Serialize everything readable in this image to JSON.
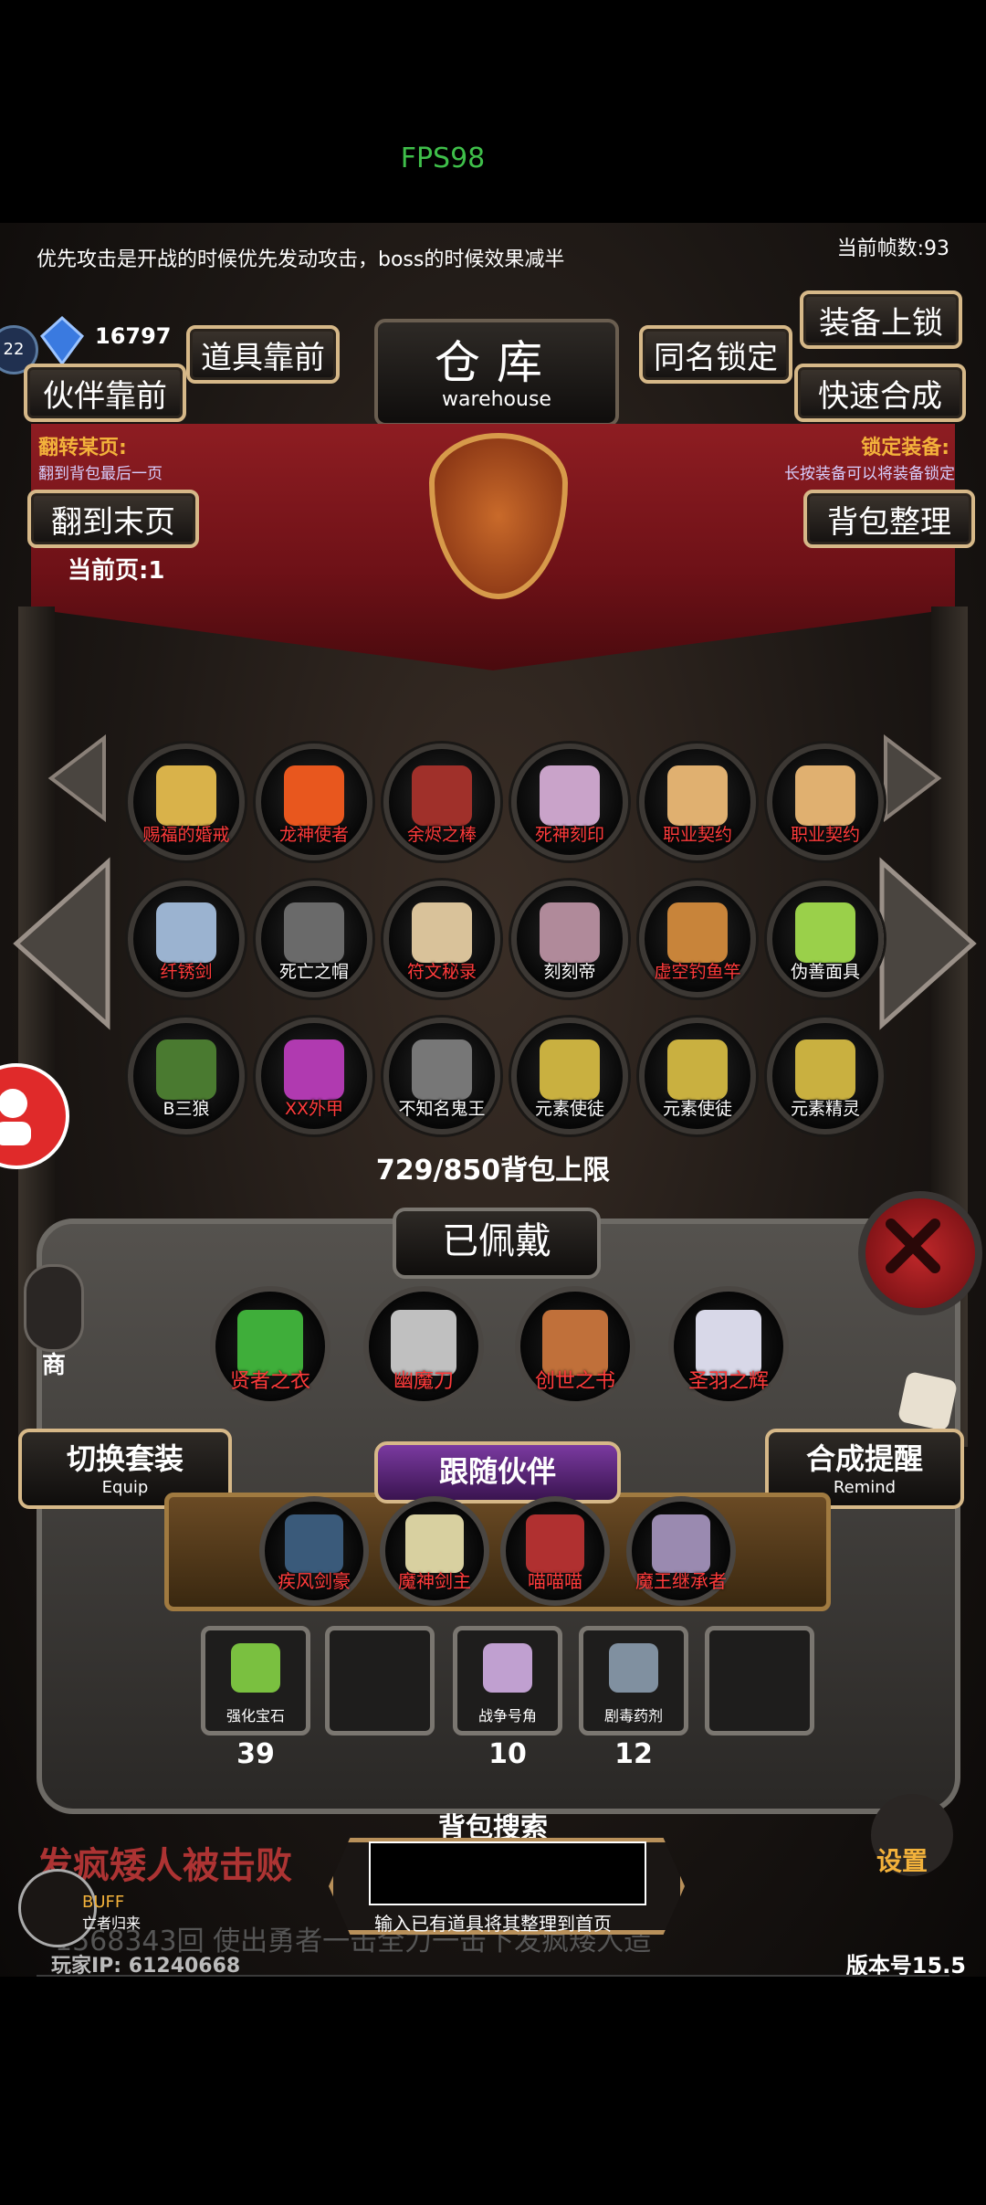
{
  "status": {
    "fps": "FPS98"
  },
  "header": {
    "tip": "优先攻击是开战的时候优先发动攻击，boss的时候效果减半",
    "frame_rate": "当前帧数:93",
    "gems": "16797",
    "level": "22"
  },
  "buttons": {
    "items_front": "道具靠前",
    "partner_front": "伙伴靠前",
    "same_name_lock": "同名锁定",
    "equip_lock": "装备上锁",
    "quick_merge": "快速合成",
    "to_last_page": "翻到末页",
    "bag_sort": "背包整理",
    "switch_set": "切换套装",
    "switch_set_sub": "Equip",
    "merge_remind": "合成提醒",
    "merge_remind_sub": "Remind",
    "settings": "设置"
  },
  "warehouse": {
    "title": "仓库",
    "subtitle": "warehouse"
  },
  "info": {
    "flip_title": "翻转某页:",
    "flip_desc": "翻到背包最后一页",
    "lock_title": "锁定装备:",
    "lock_desc": "长按装备可以将装备锁定",
    "current_page": "当前页:1"
  },
  "items": [
    {
      "name": "赐福的婚戒",
      "color": "#d9b24a",
      "label_color": "red"
    },
    {
      "name": "龙神使者",
      "color": "#e8571e",
      "label_color": "red"
    },
    {
      "name": "余烬之棒",
      "color": "#a0302a",
      "label_color": "red"
    },
    {
      "name": "死神刻印",
      "color": "#c9a3c9",
      "label_color": "red"
    },
    {
      "name": "职业契约",
      "color": "#e0b070",
      "label_color": "red"
    },
    {
      "name": "职业契约",
      "color": "#e0b070",
      "label_color": "red"
    },
    {
      "name": "纤锈剑",
      "color": "#9bb3d0",
      "label_color": "red"
    },
    {
      "name": "死亡之帽",
      "color": "#6a6a6a",
      "label_color": "white"
    },
    {
      "name": "符文秘录",
      "color": "#d9c29a",
      "label_color": "red"
    },
    {
      "name": "刻刻帝",
      "color": "#b08a9a",
      "label_color": "white"
    },
    {
      "name": "虚空钓鱼竿",
      "color": "#c8843a",
      "label_color": "red"
    },
    {
      "name": "伪善面具",
      "color": "#9ad04a",
      "label_color": "white"
    },
    {
      "name": "B三狼",
      "color": "#4a7a30",
      "label_color": "white"
    },
    {
      "name": "XX外甲",
      "color": "#b03ab0",
      "label_color": "red"
    },
    {
      "name": "不知名鬼王",
      "color": "#777777",
      "label_color": "white"
    },
    {
      "name": "元素使徒",
      "color": "#c9b040",
      "label_color": "white"
    },
    {
      "name": "元素使徒",
      "color": "#c9b040",
      "label_color": "white"
    },
    {
      "name": "元素精灵",
      "color": "#c9b040",
      "label_color": "white"
    }
  ],
  "capacity": "729/850背包上限",
  "equipped": {
    "title": "已佩戴",
    "items": [
      {
        "name": "贤者之衣",
        "color": "#3fae3a"
      },
      {
        "name": "幽魔刀",
        "color": "#c0c0c0"
      },
      {
        "name": "创世之书",
        "color": "#c0703a"
      },
      {
        "name": "圣羽之辉",
        "color": "#d8d8e8"
      }
    ]
  },
  "followers": {
    "title": "跟随伙伴",
    "items": [
      {
        "name": "疾风剑豪",
        "color": "#3a5a7a"
      },
      {
        "name": "魔神剑主",
        "color": "#d8d0a0"
      },
      {
        "name": "喵喵喵",
        "color": "#b03030"
      },
      {
        "name": "魔王继承者",
        "color": "#9a8ab0"
      }
    ]
  },
  "consumables": [
    {
      "name": "强化宝石",
      "count": "39",
      "color": "#7ac040"
    },
    {
      "name": "",
      "count": "",
      "color": ""
    },
    {
      "name": "战争号角",
      "count": "10",
      "color": "#c0a0d0"
    },
    {
      "name": "剧毒药剂",
      "count": "12",
      "color": "#8090a0"
    },
    {
      "name": "",
      "count": "",
      "color": ""
    }
  ],
  "search": {
    "title": "背包搜索",
    "value": "",
    "hint": "输入已有道具将其整理到首页"
  },
  "footer": {
    "event": "发疯矮人被击败",
    "scroll": "1568343回 使出勇者一击全力一击下发疯矮人造",
    "player_ip": "玩家IP:  61240668",
    "version": "版本号15.5",
    "buff": "BUFF",
    "buff_sub": "亡者归来",
    "shop": "商"
  },
  "colors": {
    "accent_gold": "#d6b888",
    "banner_red": "#8e1d22",
    "item_name_red": "#ff3b3b"
  }
}
